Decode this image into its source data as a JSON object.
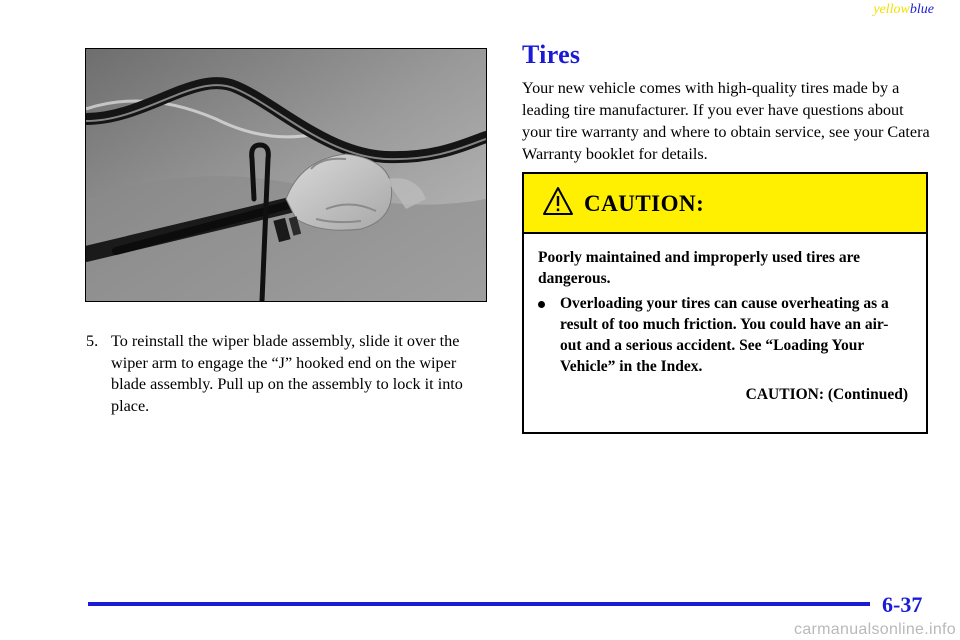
{
  "header": {
    "color_word_1": "yellow",
    "color_word_2": "blue"
  },
  "left": {
    "step": {
      "number": "5.",
      "text": "To reinstall the wiper blade assembly, slide it over the wiper arm to engage the “J” hooked end on the wiper blade assembly. Pull up on the assembly to lock it into place."
    }
  },
  "right": {
    "section_title": "Tires",
    "intro": "Your new vehicle comes with high-quality tires made by a leading tire manufacturer. If you ever have questions about your tire warranty and where to obtain service, see your Catera Warranty booklet for details.",
    "caution": {
      "title": "CAUTION:",
      "lead": "Poorly maintained and improperly used tires are dangerous.",
      "bullets": [
        "Overloading your tires can cause overheating as a result of too much friction. You could have an air-out and a serious accident. See “Loading Your Vehicle” in the Index."
      ],
      "continued": "CAUTION: (Continued)"
    }
  },
  "footer": {
    "page_number": "6-37"
  },
  "watermark": "carmanualsonline.info",
  "colors": {
    "accent_blue": "#1b1bd6",
    "caution_yellow": "#ffef00",
    "header_yellow": "#f2e000"
  }
}
